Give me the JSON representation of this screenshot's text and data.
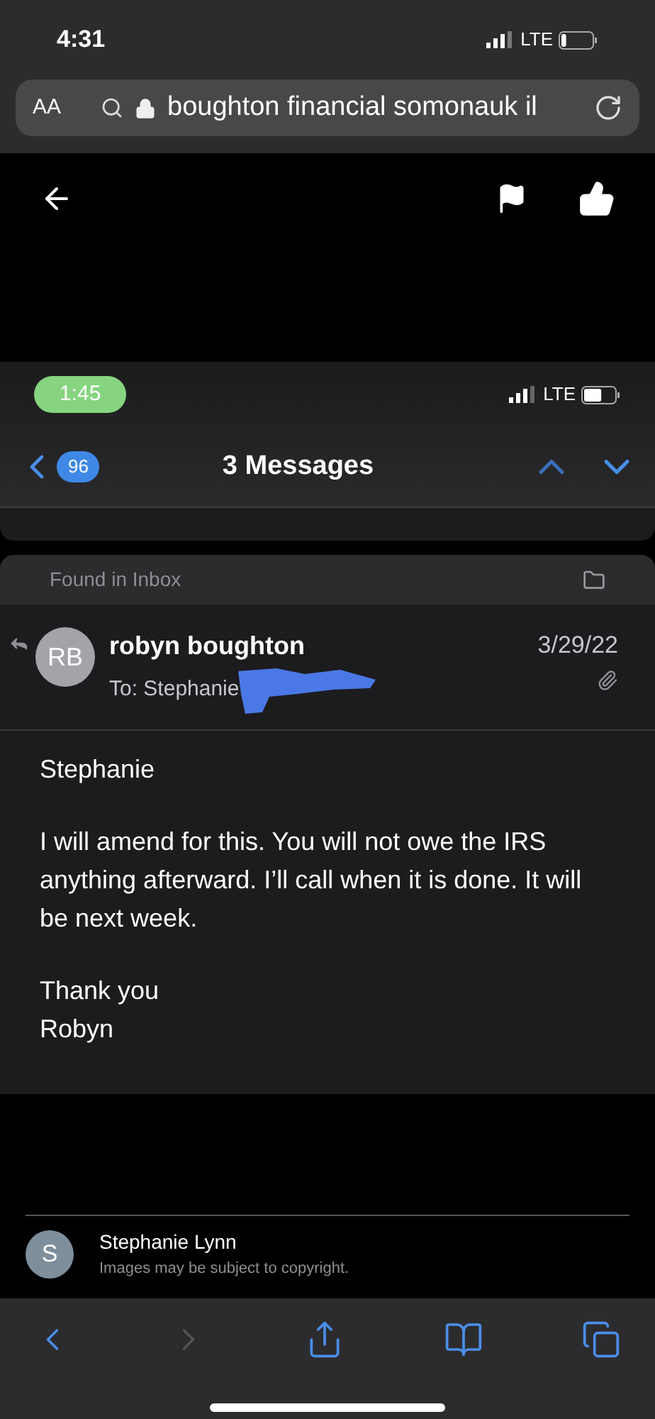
{
  "status_bar": {
    "time": "4:31",
    "network": "LTE"
  },
  "address_bar": {
    "text_size": "AA",
    "query": "boughton financial somonauk il"
  },
  "viewer_toolbar": {
    "buttons": [
      {
        "kind": "back"
      },
      {
        "kind": "flag"
      },
      {
        "kind": "like"
      }
    ]
  },
  "screenshot": {
    "status_bar": {
      "time": "1:45",
      "network": "LTE"
    },
    "nav": {
      "badge": "96",
      "title": "3 Messages"
    },
    "found_in": "Found in Inbox",
    "message": {
      "avatar": "RB",
      "sender": "robyn boughton",
      "to": "To: Stephanie",
      "date": "3/29/22",
      "body": [
        "Stephanie",
        "I will amend for this.  You will not owe the IRS anything afterward.  I’ll call when it is done.  It will be next week.",
        "Thank you\nRobyn"
      ]
    }
  },
  "source": {
    "avatar": "S",
    "name": "Stephanie Lynn",
    "note": "Images may be subject to copyright."
  },
  "browser_toolbar": [
    {
      "kind": "back",
      "disabled": false
    },
    {
      "kind": "forward",
      "disabled": true
    },
    {
      "kind": "share",
      "disabled": false
    },
    {
      "kind": "bookmarks",
      "disabled": false
    },
    {
      "kind": "tabs",
      "disabled": false
    }
  ]
}
